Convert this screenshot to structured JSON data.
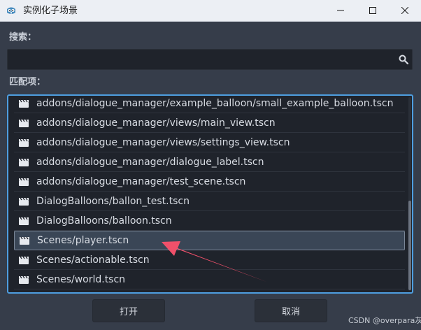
{
  "window": {
    "title": "实例化子场景",
    "app_icon": "godot-icon",
    "controls": [
      "minimize-icon",
      "maximize-icon",
      "close-icon"
    ]
  },
  "search": {
    "label": "搜索：",
    "value": "",
    "placeholder": "",
    "icon": "search-icon"
  },
  "matches": {
    "label": "匹配项：",
    "items": [
      {
        "label": "addons/dialogue_manager/example_balloon/small_example_balloon.tscn",
        "icon": "scene-clapperboard-icon",
        "selected": false
      },
      {
        "label": "addons/dialogue_manager/views/main_view.tscn",
        "icon": "scene-clapperboard-icon",
        "selected": false
      },
      {
        "label": "addons/dialogue_manager/views/settings_view.tscn",
        "icon": "scene-clapperboard-icon",
        "selected": false
      },
      {
        "label": "addons/dialogue_manager/dialogue_label.tscn",
        "icon": "scene-clapperboard-icon",
        "selected": false
      },
      {
        "label": "addons/dialogue_manager/test_scene.tscn",
        "icon": "scene-clapperboard-icon",
        "selected": false
      },
      {
        "label": "DialogBalloons/ballon_test.tscn",
        "icon": "scene-clapperboard-icon",
        "selected": false
      },
      {
        "label": "DialogBalloons/balloon.tscn",
        "icon": "scene-clapperboard-icon",
        "selected": false
      },
      {
        "label": "Scenes/player.tscn",
        "icon": "scene-clapperboard-icon",
        "selected": true
      },
      {
        "label": "Scenes/actionable.tscn",
        "icon": "scene-clapperboard-icon",
        "selected": false
      },
      {
        "label": "Scenes/world.tscn",
        "icon": "scene-clapperboard-icon",
        "selected": false
      }
    ]
  },
  "buttons": {
    "open": "打开",
    "cancel": "取消"
  },
  "watermark": "CSDN @overpara灰",
  "colors": {
    "accent": "#4e9ee0",
    "selection": "#3a4656",
    "annotation_arrow": "#f0506a"
  }
}
